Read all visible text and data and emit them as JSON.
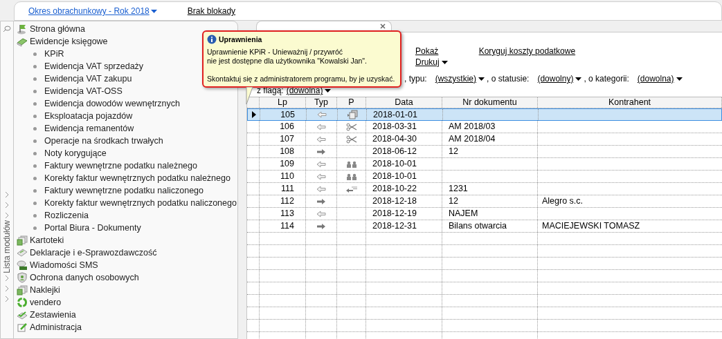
{
  "top_bar": {
    "period": "Okres obrachunkowy - Rok 2018",
    "lock": "Brak blokady"
  },
  "sidebar": {
    "title": "Lista modułów",
    "items": [
      {
        "label": "Strona główna",
        "kind": "flag"
      },
      {
        "label": "Ewidencje księgowe",
        "kind": "book",
        "children": [
          {
            "label": "KPiR"
          },
          {
            "label": "Ewidencja VAT sprzedaży"
          },
          {
            "label": "Ewidencja VAT zakupu"
          },
          {
            "label": "Ewidencja VAT-OSS"
          },
          {
            "label": "Ewidencja dowodów wewnętrznych"
          },
          {
            "label": "Eksploatacja pojazdów"
          },
          {
            "label": "Ewidencja remanentów"
          },
          {
            "label": "Operacje na środkach trwałych"
          },
          {
            "label": "Noty korygujące"
          },
          {
            "label": "Faktury wewnętrzne podatku należnego"
          },
          {
            "label": "Korekty faktur wewnętrznych podatku należnego"
          },
          {
            "label": "Faktury wewnętrzne podatku naliczonego"
          },
          {
            "label": "Korekty faktur wewnętrznych podatku naliczonego"
          },
          {
            "label": "Rozliczenia"
          },
          {
            "label": "Portal Biura - Dokumenty"
          }
        ]
      },
      {
        "label": "Kartoteki",
        "kind": "cards"
      },
      {
        "label": "Deklaracje i e-Sprawozdawczość",
        "kind": "form"
      },
      {
        "label": "Wiadomości SMS",
        "kind": "sms"
      },
      {
        "label": "Ochrona danych osobowych",
        "kind": "shield"
      },
      {
        "label": "Naklejki",
        "kind": "cards"
      },
      {
        "label": "vendero",
        "kind": "ring"
      },
      {
        "label": "Zestawienia",
        "kind": "check"
      },
      {
        "label": "Administracja",
        "kind": "pencil"
      }
    ]
  },
  "toolbar": {
    "links": [
      {
        "label": "Pokaż",
        "dropdown": false
      },
      {
        "label": "Drukuj",
        "dropdown": true
      },
      {
        "label": "Koryguj koszty podatkowe",
        "dropdown": false
      }
    ]
  },
  "filters": [
    {
      "label": ", typu:",
      "value": "(wszystkie)"
    },
    {
      "label": ", o statusie:",
      "value": "(dowolny)"
    },
    {
      "label": ", o kategorii:",
      "value": "(dowolna)"
    }
  ],
  "flag_filter": {
    "label": "z flagą:",
    "value": "(dowolna)"
  },
  "tooltip": {
    "title": "Uprawnienia",
    "lines": [
      "Uprawnienie KPiR - Unieważnij / przywróć",
      "nie jest dostępne dla użytkownika \"Kowalski Jan\".",
      "Skontaktuj się z administratorem programu, by je uzyskać."
    ]
  },
  "table": {
    "columns": [
      "Lp",
      "Typ",
      "P",
      "Data",
      "Nr dokumentu",
      "Kontrahent"
    ],
    "rows": [
      {
        "lp": "105",
        "typ": {
          "kind": "in"
        },
        "p": {
          "kind": "copy"
        },
        "data": "2018-01-01",
        "selected": true
      },
      {
        "lp": "106",
        "typ": {
          "kind": "in"
        },
        "p": {
          "kind": "scissors"
        },
        "data": "2018-03-31",
        "nr": "AM 2018/03",
        "selected": false
      },
      {
        "lp": "107",
        "typ": {
          "kind": "in"
        },
        "p": {
          "kind": "scissors"
        },
        "data": "2018-04-30",
        "nr": "AM 2018/04",
        "selected": false
      },
      {
        "lp": "108",
        "typ": {
          "kind": "out"
        },
        "data": "2018-06-12",
        "nr": "12",
        "selected": false
      },
      {
        "lp": "109",
        "typ": {
          "kind": "in"
        },
        "p": {
          "kind": "people"
        },
        "data": "2018-10-01",
        "selected": false
      },
      {
        "lp": "110",
        "typ": {
          "kind": "in"
        },
        "p": {
          "kind": "people"
        },
        "data": "2018-10-01",
        "selected": false
      },
      {
        "lp": "111",
        "typ": {
          "kind": "in"
        },
        "p": {
          "kind": "list"
        },
        "data": "2018-10-22",
        "nr": "1231",
        "selected": false
      },
      {
        "lp": "112",
        "typ": {
          "kind": "out"
        },
        "data": "2018-12-18",
        "nr": "12",
        "kontrahent": "Alegro s.c.",
        "selected": false
      },
      {
        "lp": "113",
        "typ": {
          "kind": "in"
        },
        "data": "2018-12-19",
        "nr": "NAJEM",
        "selected": false
      },
      {
        "lp": "114",
        "typ": {
          "kind": "out"
        },
        "data": "2018-12-31",
        "nr": "Bilans otwarcia",
        "kontrahent": "MACIEJEWSKI TOMASZ",
        "selected": false
      }
    ]
  }
}
